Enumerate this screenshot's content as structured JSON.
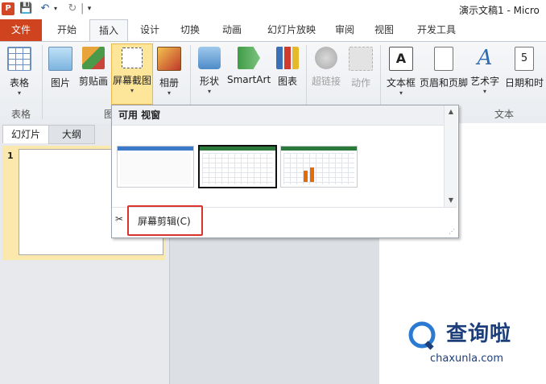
{
  "window": {
    "title": "演示文稿1 - Micro",
    "app_icon": "P"
  },
  "quick_access": {
    "icons": [
      "powerpoint-app-icon",
      "save-icon",
      "undo-icon",
      "redo-icon",
      "customize-icon"
    ]
  },
  "tabs": [
    "文件",
    "开始",
    "插入",
    "设计",
    "切换",
    "动画",
    "幻灯片放映",
    "审阅",
    "视图",
    "开发工具"
  ],
  "active_tab": "插入",
  "ribbon": {
    "buttons": [
      {
        "label": "表格",
        "icon": "table-icon",
        "has_arrow": true,
        "enabled": true
      },
      {
        "label": "图片",
        "icon": "picture-icon",
        "has_arrow": false,
        "enabled": true
      },
      {
        "label": "剪贴画",
        "icon": "clipart-icon",
        "has_arrow": false,
        "enabled": true
      },
      {
        "label": "屏幕截图",
        "icon": "screenshot-icon",
        "has_arrow": true,
        "enabled": true,
        "pressed": true
      },
      {
        "label": "相册",
        "icon": "photo-album-icon",
        "has_arrow": true,
        "enabled": true
      },
      {
        "label": "形状",
        "icon": "shapes-icon",
        "has_arrow": true,
        "enabled": true
      },
      {
        "label": "SmartArt",
        "icon": "smartart-icon",
        "has_arrow": false,
        "enabled": true
      },
      {
        "label": "图表",
        "icon": "chart-icon",
        "has_arrow": false,
        "enabled": true
      },
      {
        "label": "超链接",
        "icon": "hyperlink-icon",
        "has_arrow": false,
        "enabled": false
      },
      {
        "label": "动作",
        "icon": "action-icon",
        "has_arrow": false,
        "enabled": false
      },
      {
        "label": "文本框",
        "icon": "textbox-icon",
        "has_arrow": true,
        "enabled": true
      },
      {
        "label": "页眉和页脚",
        "icon": "header-footer-icon",
        "has_arrow": false,
        "enabled": true
      },
      {
        "label": "艺术字",
        "icon": "wordart-icon",
        "has_arrow": true,
        "enabled": true
      },
      {
        "label": "日期和时",
        "icon": "date-time-icon",
        "has_arrow": false,
        "enabled": true
      }
    ],
    "groups": {
      "table": "表格",
      "images": "图",
      "text": "文本"
    }
  },
  "left_panel": {
    "tabs": [
      "幻灯片",
      "大纲"
    ],
    "slide_number": "1"
  },
  "screenshot_dropdown": {
    "header": "可用 视窗",
    "windows": [
      {
        "name": "window-thumbnail-1",
        "selected": false,
        "kind": "dialog"
      },
      {
        "name": "window-thumbnail-2",
        "selected": true,
        "kind": "spreadsheet"
      },
      {
        "name": "window-thumbnail-3",
        "selected": false,
        "kind": "chart"
      }
    ],
    "screen_clipping_label": "屏幕剪辑(C)"
  },
  "watermark": {
    "text": "查询啦",
    "url": "chaxunla.com"
  },
  "colors": {
    "file_tab": "#d0431f",
    "pressed_button": "#fde69a",
    "highlight_box": "#d9342b",
    "watermark": "#1c3e7a"
  }
}
